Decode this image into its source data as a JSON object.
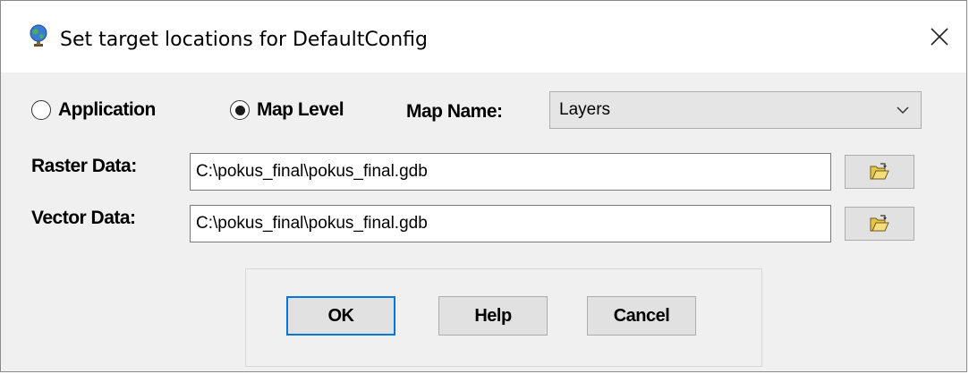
{
  "window": {
    "title": "Set target locations for DefaultConfig",
    "icon": "globe-icon",
    "close_icon": "close-icon"
  },
  "options": {
    "application_label": "Application",
    "map_level_label": "Map Level",
    "selected": "Map Level"
  },
  "map_name": {
    "label": "Map Name:",
    "value": "Layers"
  },
  "raster": {
    "label": "Raster Data:",
    "path": "C:\\pokus_final\\pokus_final.gdb",
    "browse_icon": "open-folder-icon"
  },
  "vector": {
    "label": "Vector Data:",
    "path": "C:\\pokus_final\\pokus_final.gdb",
    "browse_icon": "open-folder-icon"
  },
  "buttons": {
    "ok": "OK",
    "help": "Help",
    "cancel": "Cancel"
  }
}
